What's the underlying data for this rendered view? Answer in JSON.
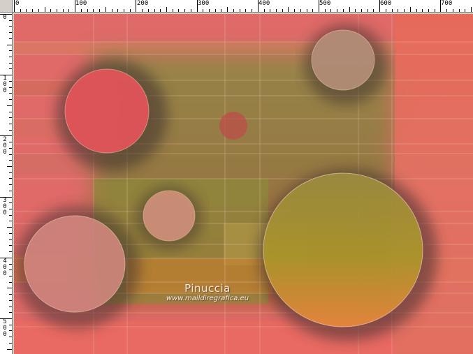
{
  "ruler": {
    "top_labels": [
      "0",
      "100",
      "200",
      "300",
      "400",
      "500",
      "600",
      "700"
    ],
    "left_labels": [
      "0",
      "100",
      "200",
      "300",
      "400",
      "500"
    ]
  },
  "colors": {
    "ruler_bg": "#ffffff",
    "frame_bg": "#d4d0c8",
    "canvas_red": "#e46d6d",
    "canvas_olive": "#8a8a3a",
    "canvas_orange": "#e8962e"
  },
  "watermark": {
    "title": "Pinuccia",
    "url": "www.maildiregrafica.eu"
  }
}
